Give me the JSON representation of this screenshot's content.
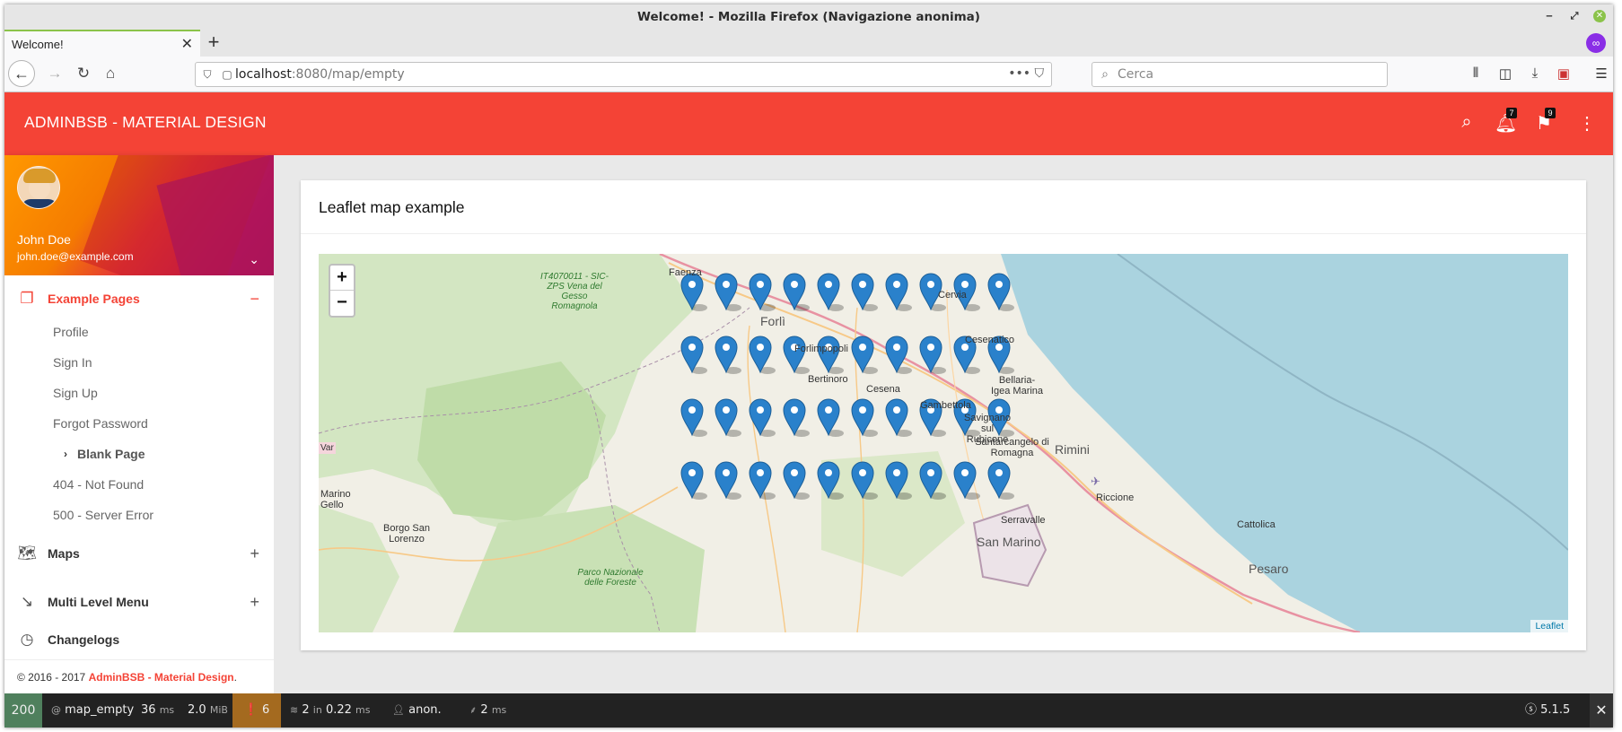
{
  "browser": {
    "window_title": "Welcome! - Mozilla Firefox (Navigazione anonima)",
    "tab_title": "Welcome!",
    "url_host": "localhost",
    "url_path": ":8080/map/empty",
    "search_placeholder": "Cerca",
    "accent_color": "#8bc34a"
  },
  "header": {
    "brand": "ADMINBSB - MATERIAL DESIGN",
    "notifications_count": "7",
    "tasks_count": "9",
    "color": "#f44336"
  },
  "user": {
    "name": "John Doe",
    "email": "john.doe@example.com"
  },
  "sidebar": {
    "menu": [
      {
        "label": "Example Pages",
        "icon": "copy-icon",
        "toggle": "−"
      },
      {
        "label": "Maps",
        "icon": "map-icon",
        "toggle": "+"
      },
      {
        "label": "Multi Level Menu",
        "icon": "trending-down-icon",
        "toggle": "+"
      },
      {
        "label": "Changelogs",
        "icon": "history-icon"
      }
    ],
    "submenu": [
      {
        "label": "Profile"
      },
      {
        "label": "Sign In"
      },
      {
        "label": "Sign Up"
      },
      {
        "label": "Forgot Password"
      },
      {
        "label": "Blank Page"
      },
      {
        "label": "404 - Not Found"
      },
      {
        "label": "500 - Server Error"
      }
    ],
    "footer_prefix": "© 2016 - 2017 ",
    "footer_brand": "AdminBSB - Material Design",
    "footer_suffix": "."
  },
  "main": {
    "card_title": "Leaflet map example",
    "zoom_in": "+",
    "zoom_out": "−",
    "attribution": "Leaflet",
    "map_labels": [
      "Faenza",
      "IT4070011 - SIC-ZPS Vena del Gesso Romagnola",
      "Forlì",
      "Forlimpopoli",
      "Cervia",
      "Cesenatico",
      "Bertinoro",
      "Cesena",
      "Bellaria-Igea Marina",
      "Gambettola",
      "Savignano sul Rubicone",
      "Santarcangelo di Romagna",
      "Rimini",
      "Riccione",
      "Cattolica",
      "Pesaro",
      "Serravalle",
      "San Marino",
      "Borgo San Lorenzo",
      "Parco Nazionale delle Foreste",
      "Marino Gello",
      "Var"
    ],
    "markers": {
      "rows": 4,
      "cols": 10
    }
  },
  "profiler": {
    "status": "200",
    "route": "map_empty",
    "time_value": "36",
    "time_unit": "ms",
    "memory_value": "2.0",
    "memory_unit": "MiB",
    "warnings": "6",
    "db_queries": "2",
    "db_in": "in",
    "db_time": "0.22",
    "db_unit": "ms",
    "user": "anon.",
    "twig_time": "2",
    "twig_unit": "ms",
    "version": "5.1.5"
  }
}
